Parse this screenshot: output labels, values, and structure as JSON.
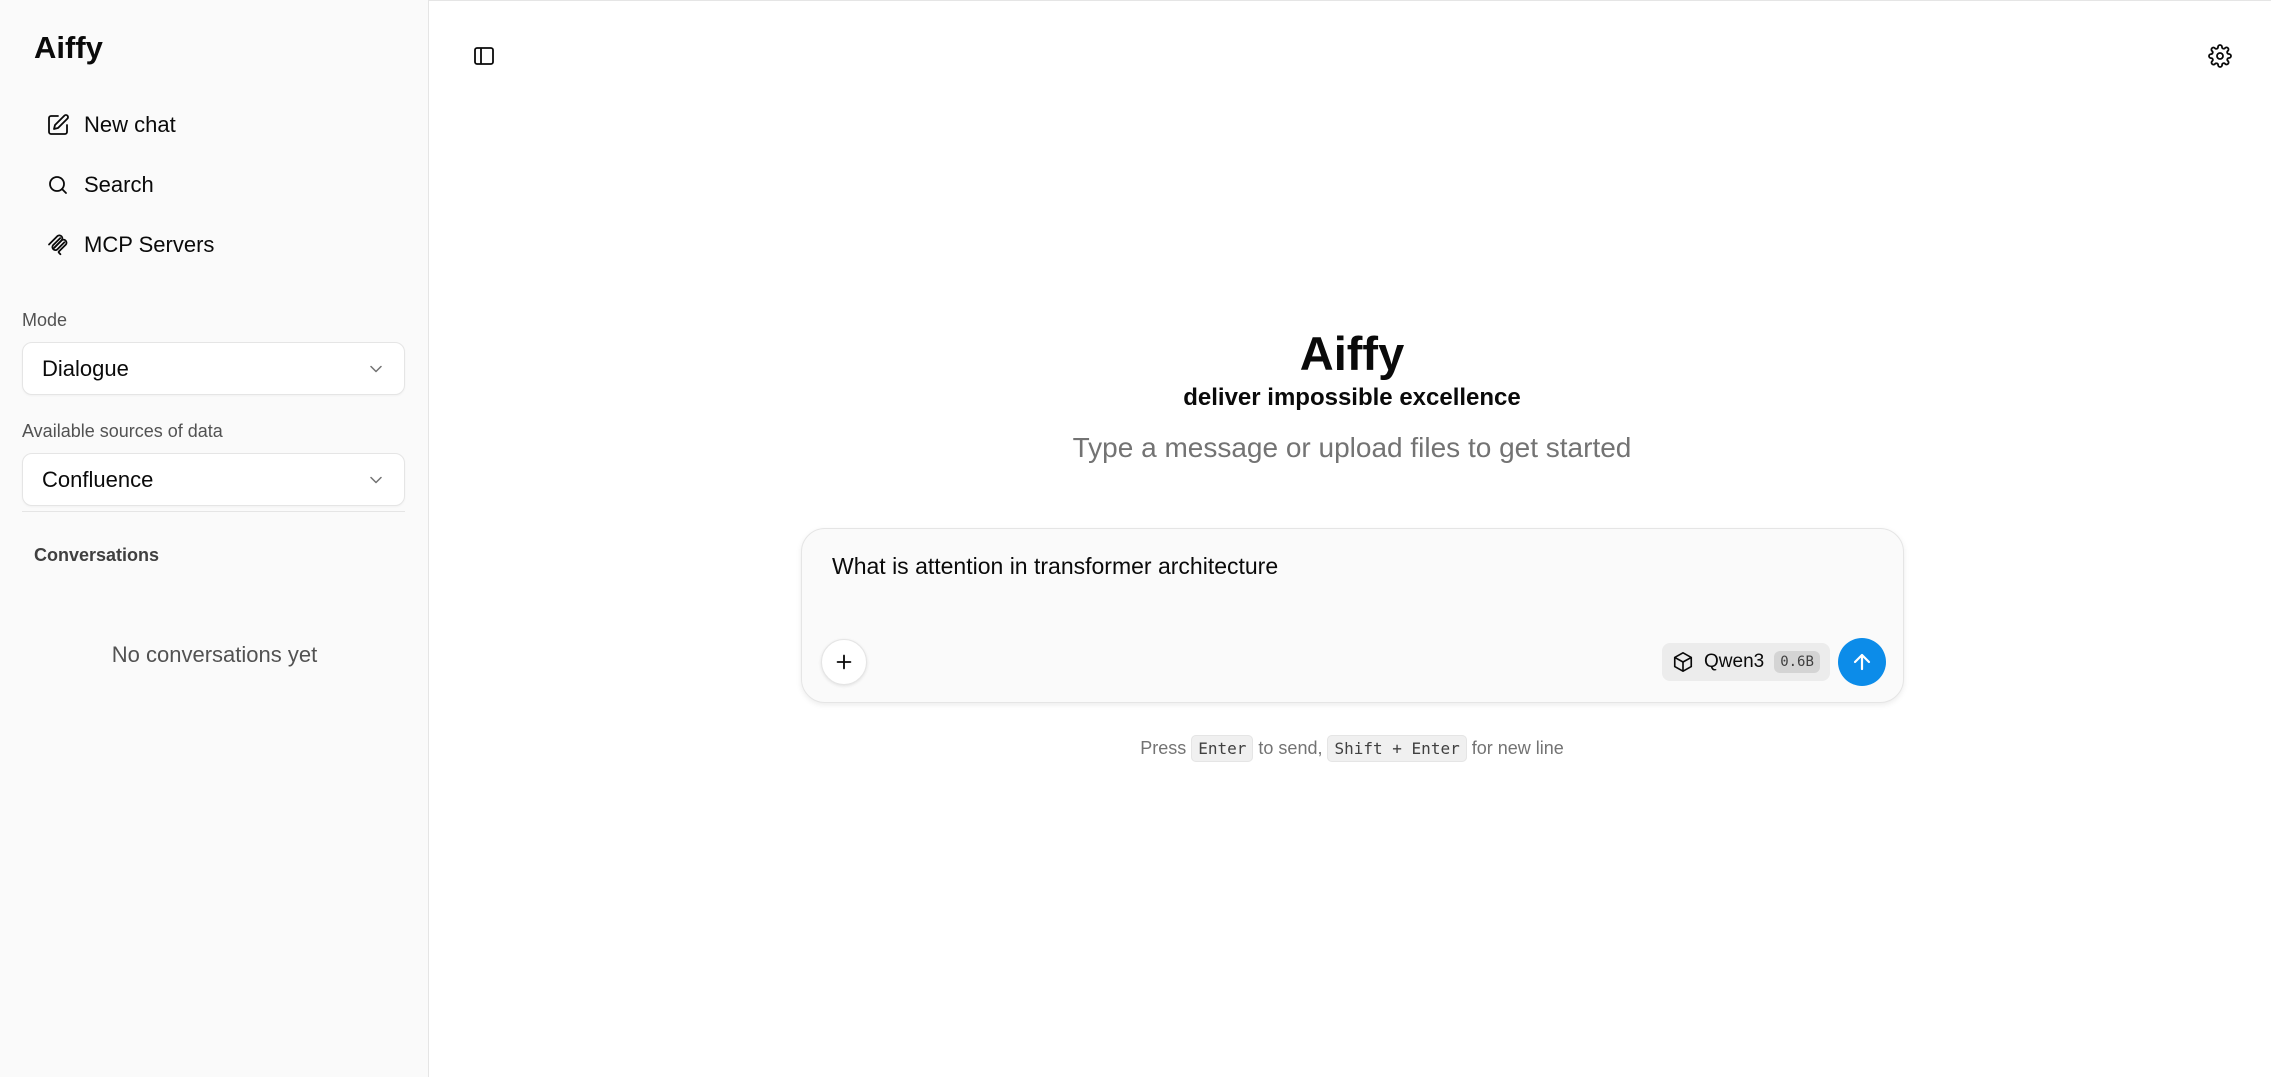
{
  "sidebar": {
    "brand": "Aiffy",
    "nav": [
      {
        "label": "New chat",
        "icon": "edit-icon"
      },
      {
        "label": "Search",
        "icon": "search-icon"
      },
      {
        "label": "MCP Servers",
        "icon": "mcp-icon"
      }
    ],
    "mode": {
      "label": "Mode",
      "value": "Dialogue"
    },
    "sources": {
      "label": "Available sources of data",
      "value": "Confluence"
    },
    "conversations": {
      "label": "Conversations",
      "empty_text": "No conversations yet"
    }
  },
  "main": {
    "hero": {
      "title": "Aiffy",
      "subtitle": "deliver impossible excellence",
      "hint": "Type a message or upload files to get started"
    },
    "composer": {
      "value": "What is attention in transformer architecture",
      "model_name": "Qwen3",
      "model_size": "0.6B"
    },
    "shortcut": {
      "press": "Press",
      "enter_key": "Enter",
      "to_send": "to send,",
      "newline_key": "Shift + Enter",
      "for_new_line": "for new line"
    }
  },
  "colors": {
    "accent": "#0c8ce9",
    "sidebar_bg": "#fafafa",
    "border": "#e5e5e5"
  }
}
